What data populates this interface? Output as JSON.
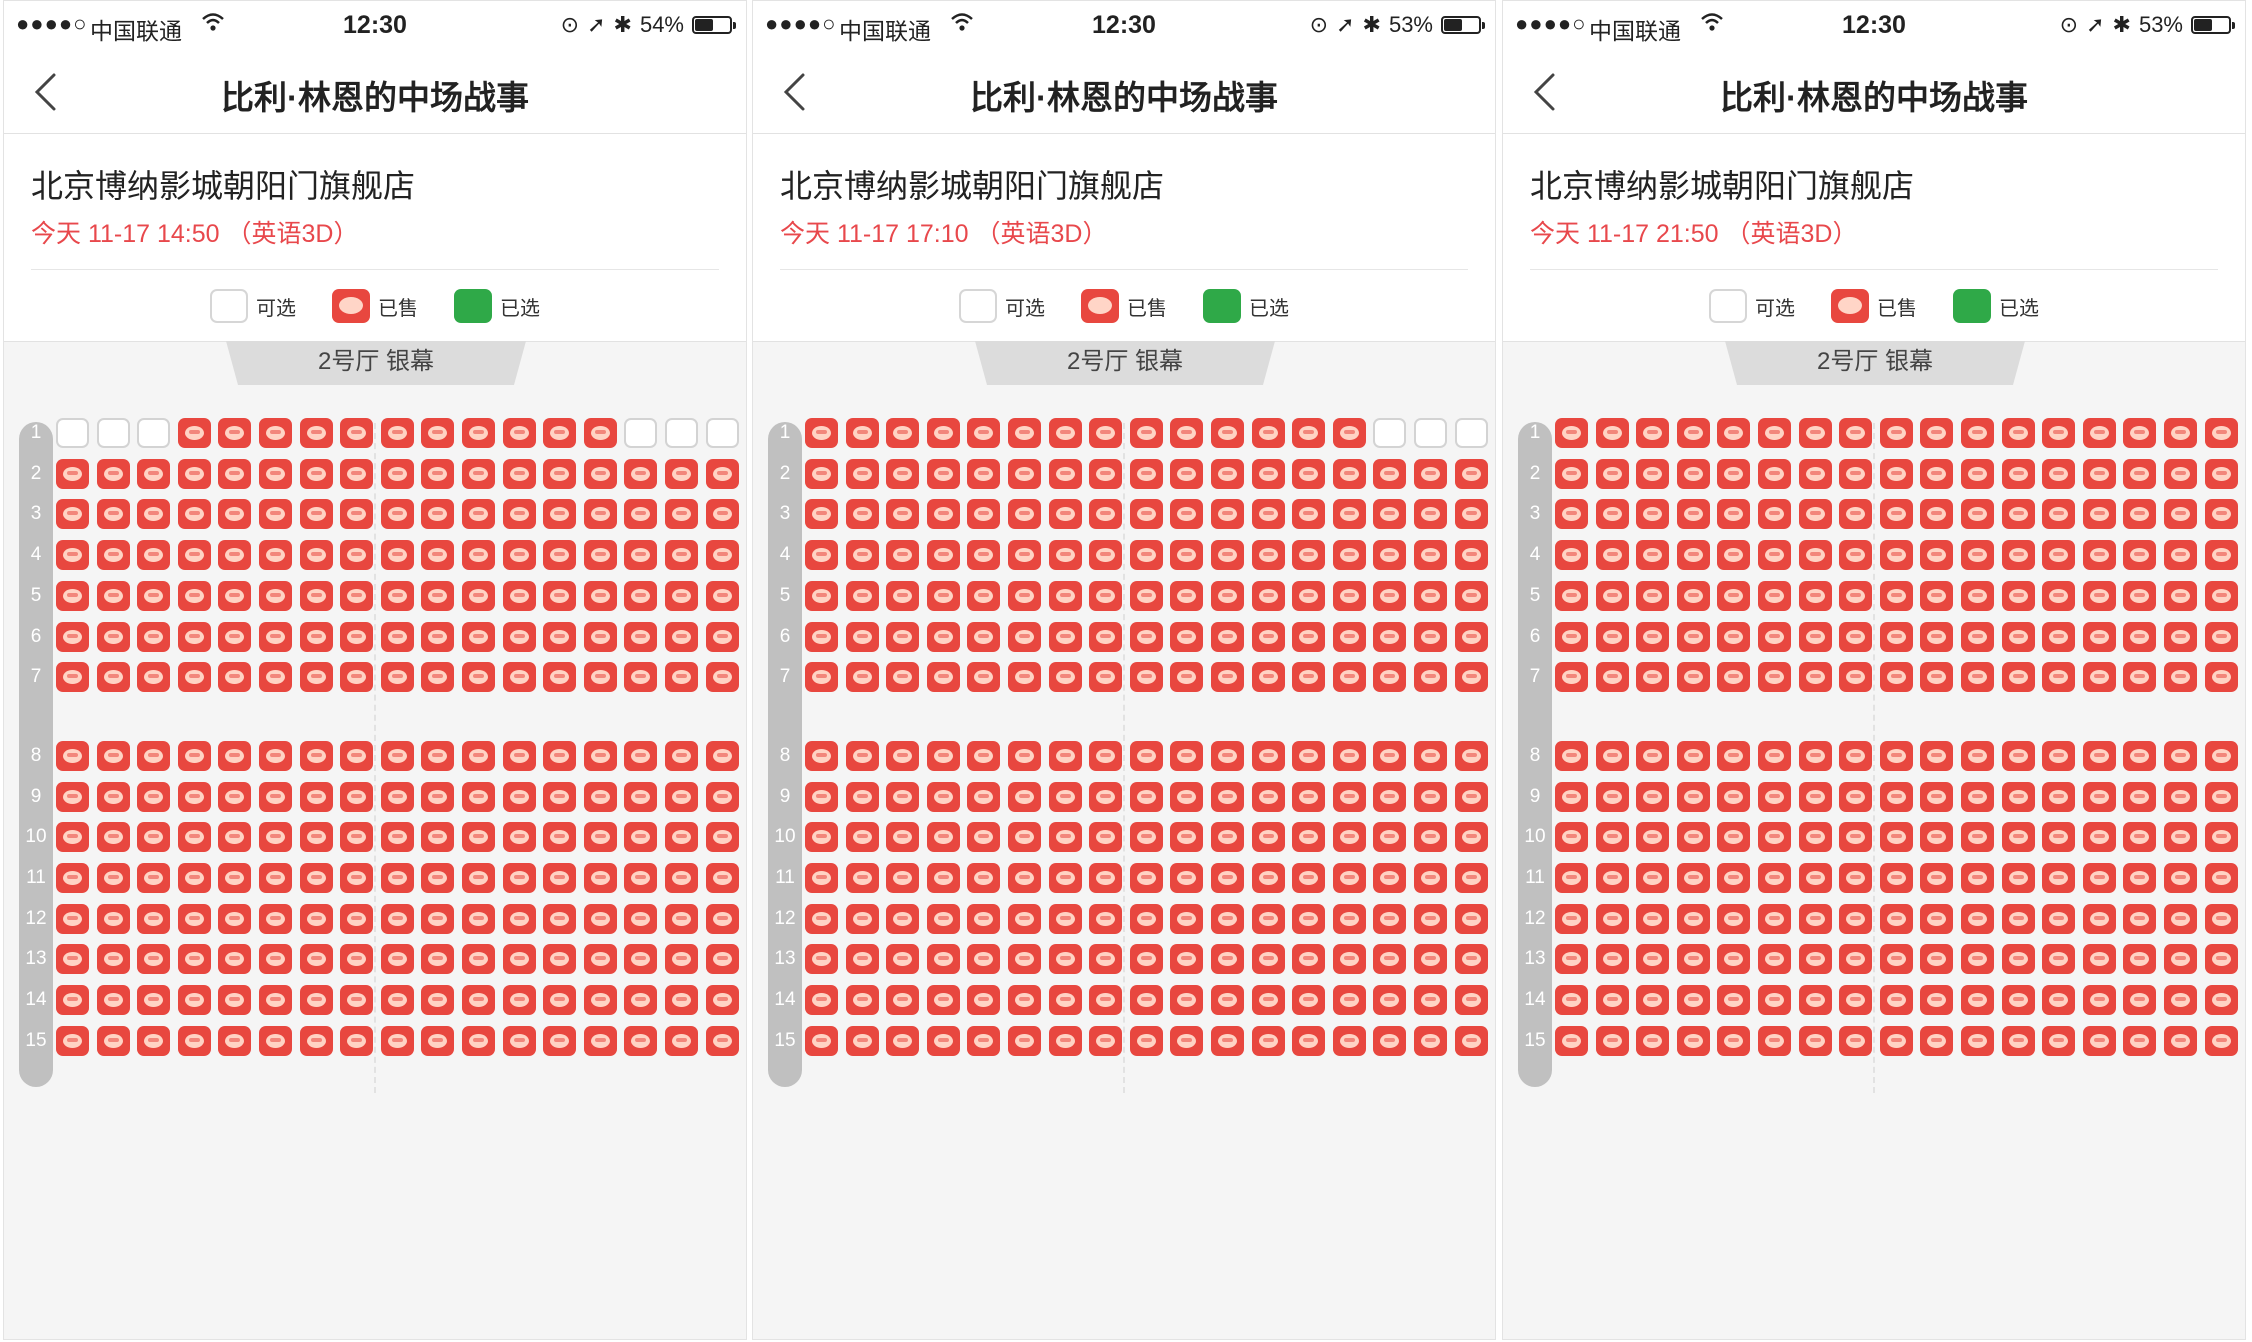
{
  "panels": [
    {
      "status": {
        "signal": "●●●●○",
        "carrier": "中国联通",
        "time": "12:30",
        "battery": "54%",
        "battery_level": 0.54
      },
      "nav_title": "比利·林恩的中场战事",
      "cinema": "北京博纳影城朝阳门旗舰店",
      "showtime": "今天 11-17 14:50 （英语3D）",
      "available_row1": [
        1,
        2,
        3,
        15,
        16,
        17
      ]
    },
    {
      "status": {
        "signal": "●●●●○",
        "carrier": "中国联通",
        "time": "12:30",
        "battery": "53%",
        "battery_level": 0.53
      },
      "nav_title": "比利·林恩的中场战事",
      "cinema": "北京博纳影城朝阳门旗舰店",
      "showtime": "今天 11-17 17:10 （英语3D）",
      "available_row1": [
        15,
        16,
        17
      ]
    },
    {
      "status": {
        "signal": "●●●●○",
        "carrier": "中国联通",
        "time": "12:30",
        "battery": "53%",
        "battery_level": 0.53
      },
      "nav_title": "比利·林恩的中场战事",
      "cinema": "北京博纳影城朝阳门旗舰店",
      "showtime": "今天 11-17 21:50 （英语3D）",
      "available_row1": []
    }
  ],
  "legend": {
    "available": "可选",
    "sold": "已售",
    "selected": "已选"
  },
  "screen_label": "2号厅 银幕",
  "seat_colors": {
    "sold": "#e8473f",
    "selected": "#2fa948",
    "available": "#ffffff"
  },
  "rows": [
    "1",
    "2",
    "3",
    "4",
    "5",
    "6",
    "7",
    "8",
    "9",
    "10",
    "11",
    "12",
    "13",
    "14",
    "15"
  ],
  "seats_per_row": 17
}
